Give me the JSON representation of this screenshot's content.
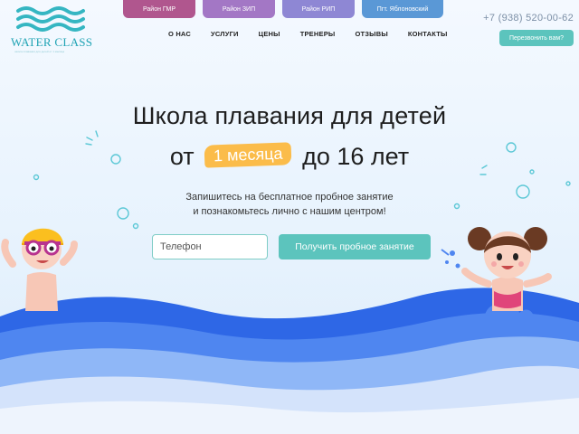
{
  "brand": {
    "name": "WATER CLASS",
    "tagline": "школа плавания для детей от 1 месяца",
    "wave_color": "#35b6c2"
  },
  "districts": [
    {
      "label": "Район ГМР",
      "color": "#b0568e"
    },
    {
      "label": "Район ЗИП",
      "color": "#a377c5"
    },
    {
      "label": "Район РИП",
      "color": "#8e87d4"
    },
    {
      "label": "Пгт. Яблоновский",
      "color": "#5a98d6"
    }
  ],
  "nav": [
    "О НАС",
    "УСЛУГИ",
    "ЦЕНЫ",
    "ТРЕНЕРЫ",
    "ОТЗЫВЫ",
    "КОНТАКТЫ"
  ],
  "contact": {
    "phone": "+7 (938) 520-00-62",
    "callback_label": "Перезвонить вам?"
  },
  "hero": {
    "title": "Школа плавания для детей",
    "line2_prefix": "от",
    "line2_highlight": "1 месяца",
    "line2_suffix": "до 16 лет",
    "lead_line1": "Запишитесь на бесплатное пробное занятие",
    "lead_line2": "и познакомьтесь лично с нашим центром!",
    "phone_placeholder": "Телефон",
    "cta_label": "Получить пробное занятие"
  },
  "colors": {
    "accent": "#5cc4bd",
    "highlight": "#fbbc4a",
    "wave_dark": "#2e67e6",
    "wave_mid": "#4f86f0"
  },
  "icons": {
    "bubbles": "bubble-icon",
    "splash": "splash-icon"
  }
}
